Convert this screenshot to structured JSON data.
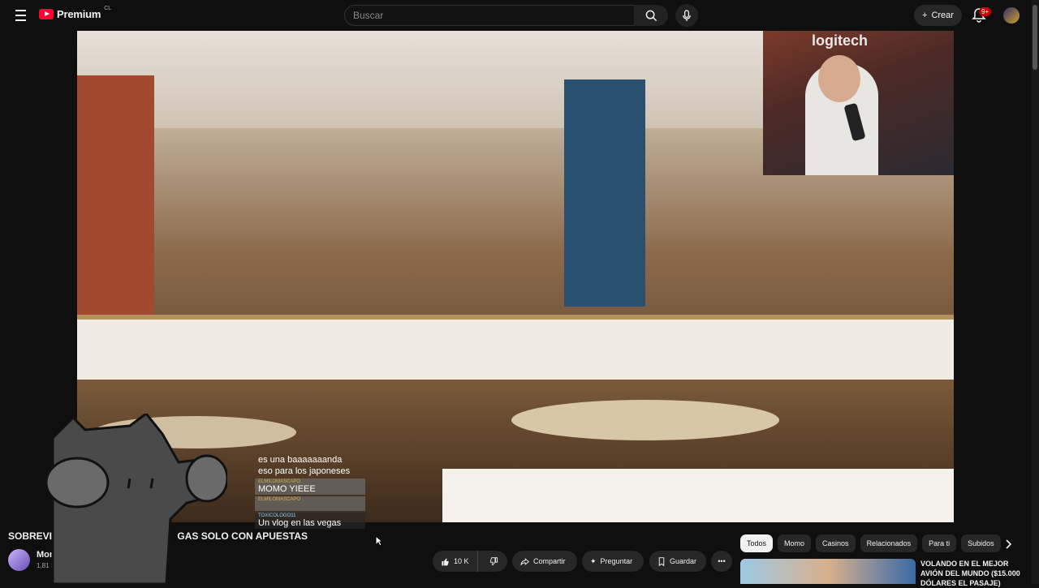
{
  "topbar": {
    "logo_text": "Premium",
    "country_code": "CL",
    "search_placeholder": "Buscar",
    "create_label": "Crear",
    "notification_count": "9+"
  },
  "player": {
    "webcam_brand": "logitech"
  },
  "chat": {
    "first_line": "es una baaaaaaanda",
    "second_line": "eso para los japoneses",
    "messages": [
      {
        "user": "ELMILOMASCAPO",
        "text": "MOMO YIEEE"
      },
      {
        "user": "ELMILOMASCAPO",
        "text": ""
      },
      {
        "user": "TOXICOLOGO11",
        "text": "Un vlog en las vegas"
      }
    ]
  },
  "video": {
    "title_left": "SOBREVIVI",
    "title_right": "GAS SOLO CON APUESTAS",
    "channel_name": "Momo",
    "subscribers": "1,81 M de"
  },
  "actions": {
    "likes": "10 K",
    "share": "Compartir",
    "ask": "Preguntar",
    "save": "Guardar"
  },
  "chips": [
    "Todos",
    "Momo",
    "Casinos",
    "Relacionados",
    "Para ti",
    "Subidos"
  ],
  "recommendation": {
    "title": "VOLANDO EN EL MEJOR AVIÓN DEL MUNDO ($15.000 DÓLARES EL PASAJE)"
  },
  "colors": {
    "background": "#0f0f0f",
    "brand_red": "#ff0033",
    "chip_active": "#f1f1f1"
  }
}
